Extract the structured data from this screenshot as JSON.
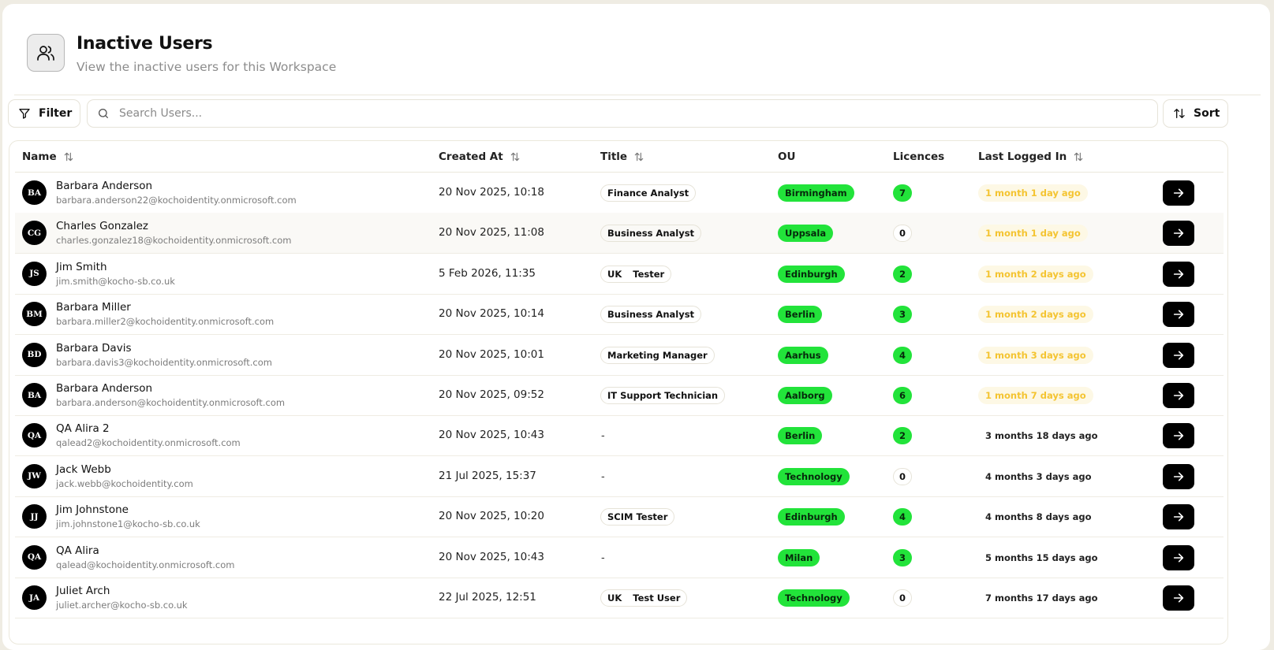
{
  "header": {
    "title": "Inactive Users",
    "subtitle": "View the inactive users for this Workspace",
    "icon": "users-icon"
  },
  "toolbar": {
    "filter_label": "Filter",
    "search_placeholder": "Search Users...",
    "sort_label": "Sort"
  },
  "table": {
    "columns": {
      "name": "Name",
      "created": "Created At",
      "title": "Title",
      "ou": "OU",
      "licences": "Licences",
      "last": "Last Logged In"
    },
    "rows": [
      {
        "initials": "BA",
        "name": "Barbara Anderson",
        "email": "barbara.anderson22@kochoidentity.onmicrosoft.com",
        "created": "20 Nov 2025, 10:18",
        "title": [
          "Finance Analyst"
        ],
        "ou": "Birmingham",
        "licences": "7",
        "last": "1 month 1 day ago"
      },
      {
        "initials": "CG",
        "name": "Charles Gonzalez",
        "email": "charles.gonzalez18@kochoidentity.onmicrosoft.com",
        "created": "20 Nov 2025, 11:08",
        "title": [
          "Business Analyst"
        ],
        "ou": "Uppsala",
        "licences": "0",
        "last": "1 month 1 day ago"
      },
      {
        "initials": "JS",
        "name": "Jim Smith",
        "email": "jim.smith@kocho-sb.co.uk",
        "created": "5 Feb 2026, 11:35",
        "title": [
          "UK",
          "Tester"
        ],
        "ou": "Edinburgh",
        "licences": "2",
        "last": "1 month 2 days ago"
      },
      {
        "initials": "BM",
        "name": "Barbara Miller",
        "email": "barbara.miller2@kochoidentity.onmicrosoft.com",
        "created": "20 Nov 2025, 10:14",
        "title": [
          "Business Analyst"
        ],
        "ou": "Berlin",
        "licences": "3",
        "last": "1 month 2 days ago"
      },
      {
        "initials": "BD",
        "name": "Barbara Davis",
        "email": "barbara.davis3@kochoidentity.onmicrosoft.com",
        "created": "20 Nov 2025, 10:01",
        "title": [
          "Marketing Manager"
        ],
        "ou": "Aarhus",
        "licences": "4",
        "last": "1 month 3 days ago"
      },
      {
        "initials": "BA",
        "name": "Barbara Anderson",
        "email": "barbara.anderson@kochoidentity.onmicrosoft.com",
        "created": "20 Nov 2025, 09:52",
        "title": [
          "IT Support Technician"
        ],
        "ou": "Aalborg",
        "licences": "6",
        "last": "1 month 7 days ago"
      },
      {
        "initials": "QA",
        "name": "QA Alira 2",
        "email": "qalead2@kochoidentity.onmicrosoft.com",
        "created": "20 Nov 2025, 10:43",
        "title": "-",
        "ou": "Berlin",
        "licences": "2",
        "last": "3 months 18 days ago"
      },
      {
        "initials": "JW",
        "name": "Jack Webb",
        "email": "jack.webb@kochoidentity.com",
        "created": "21 Jul 2025, 15:37",
        "title": "-",
        "ou": "Technology",
        "licences": "0",
        "last": "4 months 3 days ago"
      },
      {
        "initials": "JJ",
        "name": "Jim Johnstone",
        "email": "jim.johnstone1@kocho-sb.co.uk",
        "created": "20 Nov 2025, 10:20",
        "title": [
          "SCIM Tester"
        ],
        "ou": "Edinburgh",
        "licences": "4",
        "last": "4 months 8 days ago"
      },
      {
        "initials": "QA",
        "name": "QA Alira",
        "email": "qalead@kochoidentity.onmicrosoft.com",
        "created": "20 Nov 2025, 10:43",
        "title": "-",
        "ou": "Milan",
        "licences": "3",
        "last": "5 months 15 days ago"
      },
      {
        "initials": "JA",
        "name": "Juliet Arch",
        "email": "juliet.archer@kocho-sb.co.uk",
        "created": "22 Jul 2025, 12:51",
        "title": [
          "UK",
          "Test User"
        ],
        "ou": "Technology",
        "licences": "0",
        "last": "7 months 17 days ago"
      }
    ]
  },
  "colors": {
    "ou_badge": "#22e33a",
    "recent_login_text": "#f4c431",
    "recent_login_bg": "#fdf8e5",
    "action_button": "#000000"
  }
}
